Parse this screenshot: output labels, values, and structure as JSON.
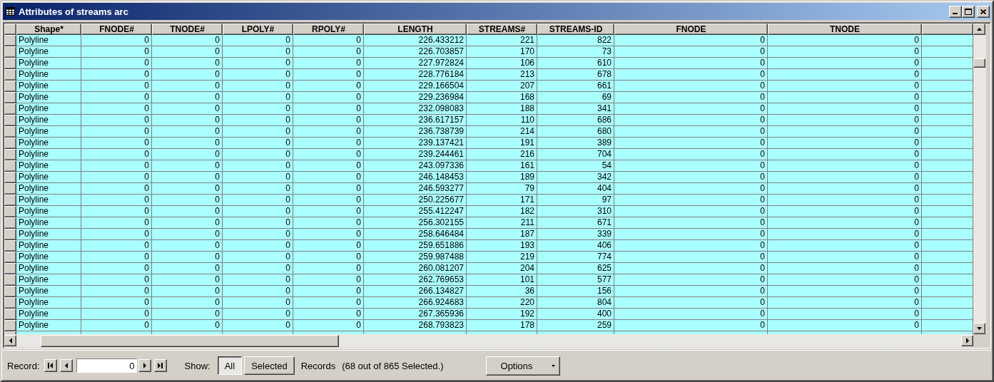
{
  "window": {
    "title": "Attributes of streams arc"
  },
  "table": {
    "columns": [
      {
        "label": "Shape*"
      },
      {
        "label": "FNODE#"
      },
      {
        "label": "TNODE#"
      },
      {
        "label": "LPOLY#"
      },
      {
        "label": "RPOLY#"
      },
      {
        "label": "LENGTH"
      },
      {
        "label": "STREAMS#"
      },
      {
        "label": "STREAMS-ID"
      },
      {
        "label": "FNODE"
      },
      {
        "label": "TNODE"
      }
    ],
    "rows": [
      {
        "cells": [
          "Polyline",
          "0",
          "0",
          "0",
          "0",
          "226.433212",
          "221",
          "822",
          "0",
          "0"
        ]
      },
      {
        "cells": [
          "Polyline",
          "0",
          "0",
          "0",
          "0",
          "226.703857",
          "170",
          "73",
          "0",
          "0"
        ]
      },
      {
        "cells": [
          "Polyline",
          "0",
          "0",
          "0",
          "0",
          "227.972824",
          "106",
          "610",
          "0",
          "0"
        ]
      },
      {
        "cells": [
          "Polyline",
          "0",
          "0",
          "0",
          "0",
          "228.776184",
          "213",
          "678",
          "0",
          "0"
        ]
      },
      {
        "cells": [
          "Polyline",
          "0",
          "0",
          "0",
          "0",
          "229.166504",
          "207",
          "661",
          "0",
          "0"
        ]
      },
      {
        "cells": [
          "Polyline",
          "0",
          "0",
          "0",
          "0",
          "229.236984",
          "168",
          "69",
          "0",
          "0"
        ]
      },
      {
        "cells": [
          "Polyline",
          "0",
          "0",
          "0",
          "0",
          "232.098083",
          "188",
          "341",
          "0",
          "0"
        ]
      },
      {
        "cells": [
          "Polyline",
          "0",
          "0",
          "0",
          "0",
          "236.617157",
          "110",
          "686",
          "0",
          "0"
        ]
      },
      {
        "cells": [
          "Polyline",
          "0",
          "0",
          "0",
          "0",
          "236.738739",
          "214",
          "680",
          "0",
          "0"
        ]
      },
      {
        "cells": [
          "Polyline",
          "0",
          "0",
          "0",
          "0",
          "239.137421",
          "191",
          "389",
          "0",
          "0"
        ]
      },
      {
        "cells": [
          "Polyline",
          "0",
          "0",
          "0",
          "0",
          "239.244461",
          "216",
          "704",
          "0",
          "0"
        ]
      },
      {
        "cells": [
          "Polyline",
          "0",
          "0",
          "0",
          "0",
          "243.097336",
          "161",
          "54",
          "0",
          "0"
        ]
      },
      {
        "cells": [
          "Polyline",
          "0",
          "0",
          "0",
          "0",
          "246.148453",
          "189",
          "342",
          "0",
          "0"
        ]
      },
      {
        "cells": [
          "Polyline",
          "0",
          "0",
          "0",
          "0",
          "246.593277",
          "79",
          "404",
          "0",
          "0"
        ]
      },
      {
        "cells": [
          "Polyline",
          "0",
          "0",
          "0",
          "0",
          "250.225677",
          "171",
          "97",
          "0",
          "0"
        ]
      },
      {
        "cells": [
          "Polyline",
          "0",
          "0",
          "0",
          "0",
          "255.412247",
          "182",
          "310",
          "0",
          "0"
        ]
      },
      {
        "cells": [
          "Polyline",
          "0",
          "0",
          "0",
          "0",
          "256.302155",
          "211",
          "671",
          "0",
          "0"
        ]
      },
      {
        "cells": [
          "Polyline",
          "0",
          "0",
          "0",
          "0",
          "258.646484",
          "187",
          "339",
          "0",
          "0"
        ]
      },
      {
        "cells": [
          "Polyline",
          "0",
          "0",
          "0",
          "0",
          "259.651886",
          "193",
          "406",
          "0",
          "0"
        ]
      },
      {
        "cells": [
          "Polyline",
          "0",
          "0",
          "0",
          "0",
          "259.987488",
          "219",
          "774",
          "0",
          "0"
        ]
      },
      {
        "cells": [
          "Polyline",
          "0",
          "0",
          "0",
          "0",
          "260.081207",
          "204",
          "625",
          "0",
          "0"
        ]
      },
      {
        "cells": [
          "Polyline",
          "0",
          "0",
          "0",
          "0",
          "262.769653",
          "101",
          "577",
          "0",
          "0"
        ]
      },
      {
        "cells": [
          "Polyline",
          "0",
          "0",
          "0",
          "0",
          "266.134827",
          "36",
          "156",
          "0",
          "0"
        ]
      },
      {
        "cells": [
          "Polyline",
          "0",
          "0",
          "0",
          "0",
          "266.924683",
          "220",
          "804",
          "0",
          "0"
        ]
      },
      {
        "cells": [
          "Polyline",
          "0",
          "0",
          "0",
          "0",
          "267.365936",
          "192",
          "400",
          "0",
          "0"
        ]
      },
      {
        "cells": [
          "Polyline",
          "0",
          "0",
          "0",
          "0",
          "268.793823",
          "178",
          "259",
          "0",
          "0"
        ]
      }
    ]
  },
  "footer": {
    "record_label": "Record:",
    "record_value": "0",
    "show_label": "Show:",
    "show_options": [
      {
        "label": "All",
        "selected": true
      },
      {
        "label": "Selected",
        "selected": false
      }
    ],
    "records_label": "Records",
    "selection_summary": "(68 out of 865 Selected.)",
    "options_button": "Options"
  }
}
